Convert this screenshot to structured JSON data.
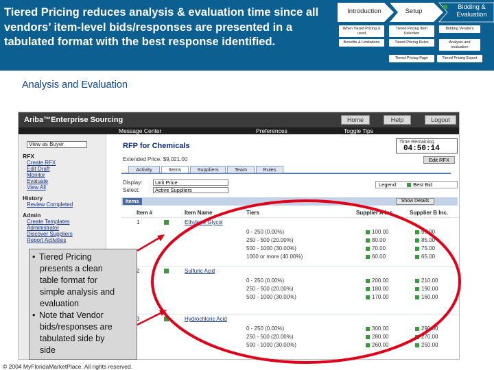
{
  "header": {
    "headline": "Tiered Pricing reduces analysis & evaluation time since all vendors’ item-level bids/responses are presented in a tabulated format with the best response identified.",
    "chevrons": [
      {
        "label": "Introduction"
      },
      {
        "label": "Setup"
      },
      {
        "label": "Bidding & Evaluation"
      }
    ],
    "steps": [
      {
        "label": "When Tiered Pricing is used"
      },
      {
        "label": "Tiered Pricing Item Selection"
      },
      {
        "label": "Bidding Vendor's"
      },
      {
        "label": "Benefits & Limitations"
      },
      {
        "label": "Tiered Pricing Rules"
      },
      {
        "label": "Analysis and evaluation"
      },
      {
        "label": "Tiered Pricing Page"
      },
      {
        "label": "Tiered Pricing Export"
      }
    ],
    "colors": {
      "band": "#0b5f91",
      "arrow": "#ffffff"
    }
  },
  "section_title": "Analysis and Evaluation",
  "app": {
    "brand": "Ariba™Enterprise Sourcing",
    "top_buttons": [
      "Home",
      "Help",
      "Logout"
    ],
    "menu": [
      "Message Center",
      "Preferences",
      "Toggle Tips"
    ],
    "sidebar": {
      "select": "View as Buyer",
      "sections": [
        {
          "title": "RFX",
          "links": [
            "Create RFX",
            "Edit Draft",
            "Monitor",
            "Evaluate",
            "View All"
          ]
        },
        {
          "title": "History",
          "links": [
            "Review Completed"
          ]
        },
        {
          "title": "Admin",
          "links": [
            "Create Templates",
            "Administrator",
            "Discover Suppliers",
            "Report Activities"
          ]
        }
      ]
    },
    "rfp_title": "RFP for Chemicals",
    "timer_label": "Time Remaining",
    "timer": "04:50:14",
    "extended_price": "Extended Price: $9,021.00",
    "edit_button": "Edit RFX",
    "tabs": [
      "Activity",
      "Items",
      "Suppliers",
      "Team",
      "Rules"
    ],
    "display_label": "Display:",
    "display_value": "Unit Price",
    "select_label": "Select:",
    "select_value": "Active Suppliers",
    "legend_label": "Legend:",
    "legend_value": "Best Bid",
    "items_tag": "Items",
    "show_details": "Show Details",
    "columns": [
      "Item #",
      "Item Name",
      "Tiers",
      "Supplier A Inc.",
      "Supplier B Inc."
    ],
    "items": [
      {
        "num": "1",
        "name": "Ethylene Glycol",
        "tiers": [
          "0 - 250 (0.00%)",
          "250 - 500 (20.00%)",
          "500 - 1000 (30.00%)",
          "1000 or more (40.00%)"
        ],
        "a": [
          "100.00",
          "80.00",
          "70.00",
          "60.00"
        ],
        "b": [
          "95.00",
          "85.00",
          "75.00",
          "65.00"
        ]
      },
      {
        "num": "2",
        "name": "Sulfuric Acid",
        "tiers": [
          "0 - 250 (0.00%)",
          "250 - 500 (20.00%)",
          "500 - 1000 (30.00%)"
        ],
        "a": [
          "200.00",
          "180.00",
          "170.00"
        ],
        "b": [
          "210.00",
          "190.00",
          "160.00"
        ]
      },
      {
        "num": "3",
        "name": "Hydrochloric Acid",
        "tiers": [
          "0 - 250 (0.00%)",
          "250 - 500 (20.00%)",
          "500 - 1000 (30.00%)"
        ],
        "a": [
          "300.00",
          "280.00",
          "260.00"
        ],
        "b": [
          "290.00",
          "270.00",
          "250.00"
        ]
      }
    ]
  },
  "callout": {
    "bullets": [
      {
        "lines": [
          "Tiered Pricing",
          "presents a clean",
          "table format for",
          "simple analysis and",
          "evaluation"
        ]
      },
      {
        "lines": [
          "Note that Vendor",
          "bids/responses are",
          "tabulated side by",
          "side"
        ]
      }
    ],
    "circle_color": "#e0001a"
  },
  "footer": "© 2004 MyFloridaMarketPlace. All rights reserved."
}
